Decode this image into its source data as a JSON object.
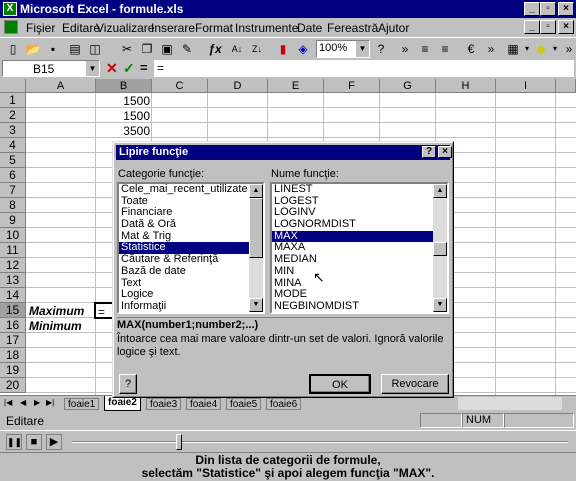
{
  "window": {
    "title": "Microsoft Excel - formule.xls"
  },
  "menu": [
    "Fişier",
    "Editare",
    "Vizualizare",
    "Inserare",
    "Format",
    "Instrumente",
    "Date",
    "Fereastră",
    "Ajutor"
  ],
  "toolbar": {
    "zoom": "100%"
  },
  "formula_bar": {
    "name_box": "B15",
    "content": "="
  },
  "sheet": {
    "columns": [
      "A",
      "B",
      "C",
      "D",
      "E",
      "F",
      "G",
      "H",
      "I"
    ],
    "rows": [
      "1",
      "2",
      "3",
      "4",
      "5",
      "6",
      "7",
      "8",
      "9",
      "10",
      "11",
      "12",
      "13",
      "14",
      "15",
      "16",
      "17",
      "18",
      "19",
      "20"
    ],
    "b1": "1500",
    "b2": "1500",
    "b3": "3500",
    "a15": "Maximum",
    "a16": "Minimum",
    "b15": "="
  },
  "sheet_tabs": [
    "foaie1",
    "foaie2",
    "foaie3",
    "foaie4",
    "foaie5",
    "foaie6"
  ],
  "status": {
    "mode": "Editare",
    "num": "NUM"
  },
  "dialog": {
    "title": "Lipire funcţie",
    "category_label": "Categorie funcţie:",
    "function_label": "Nume funcţie:",
    "categories": [
      "Cele_mai_recent_utilizate",
      "Toate",
      "Financiare",
      "Dată & Oră",
      "Mat & Trig",
      "Statistice",
      "Căutare & Referinţă",
      "Bază de date",
      "Text",
      "Logice",
      "Informaţii"
    ],
    "selected_category": "Statistice",
    "functions": [
      "LINEST",
      "LOGEST",
      "LOGINV",
      "LOGNORMDIST",
      "MAX",
      "MAXA",
      "MEDIAN",
      "MIN",
      "MINA",
      "MODE",
      "NEGBINOMDIST"
    ],
    "selected_function": "MAX",
    "syntax": "MAX(number1;number2;...)",
    "description": "Întoarce cea mai mare valoare dintr-un set de valori. Ignoră valorile logice şi text.",
    "ok": "OK",
    "cancel": "Revocare"
  },
  "caption": {
    "line1": "Din lista de categorii de formule,",
    "line2": "selectăm \"Statistice\" şi apoi alegem funcţia \"MAX\"."
  }
}
